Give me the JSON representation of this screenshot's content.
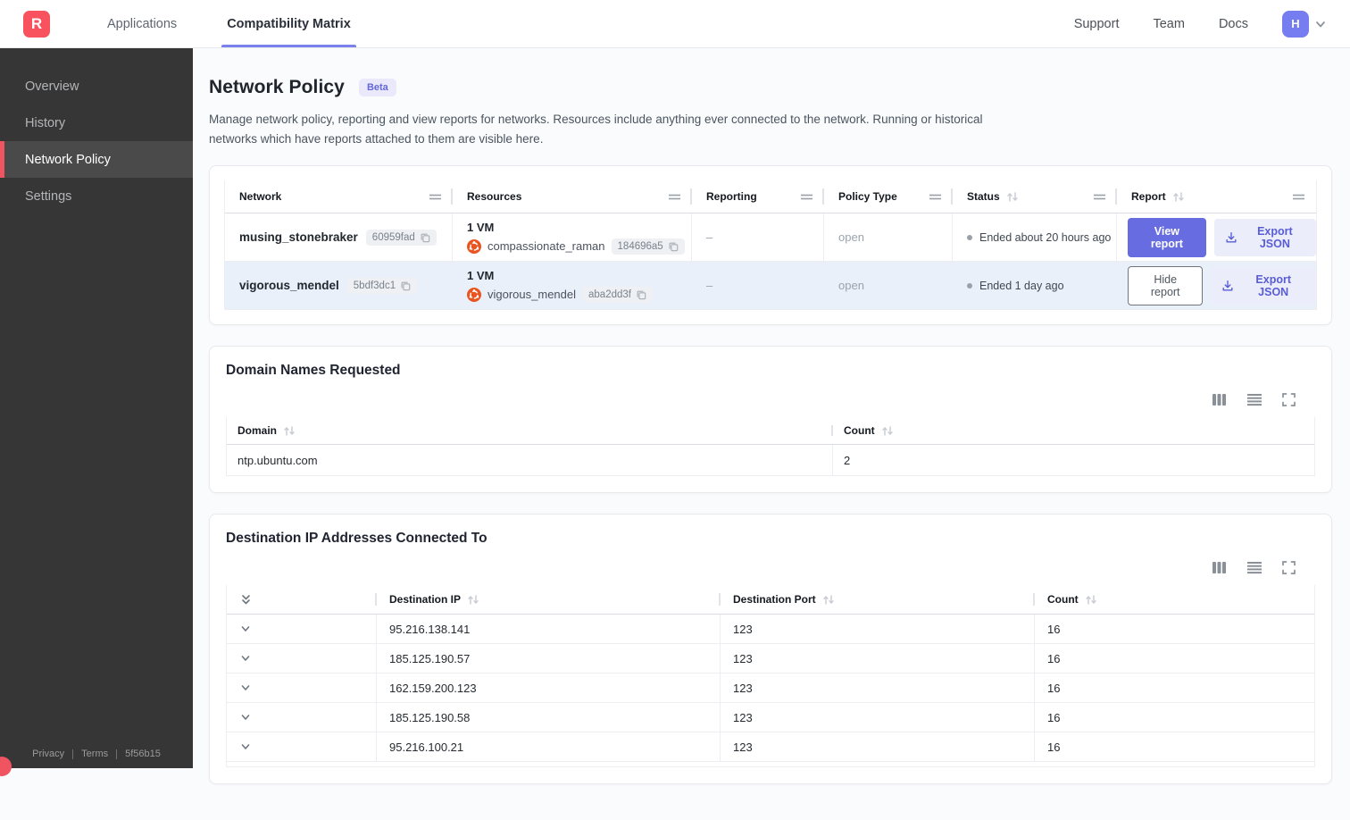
{
  "topnav": {
    "logo_letter": "R",
    "tabs": [
      {
        "label": "Applications",
        "active": false
      },
      {
        "label": "Compatibility Matrix",
        "active": true
      }
    ],
    "links": [
      "Support",
      "Team",
      "Docs"
    ],
    "avatar_letter": "H"
  },
  "sidebar": {
    "items": [
      {
        "label": "Overview",
        "active": false
      },
      {
        "label": "History",
        "active": false
      },
      {
        "label": "Network Policy",
        "active": true
      },
      {
        "label": "Settings",
        "active": false
      }
    ],
    "footer": {
      "privacy": "Privacy",
      "terms": "Terms",
      "build": "5f56b15"
    }
  },
  "page": {
    "title": "Network Policy",
    "badge": "Beta",
    "description": "Manage network policy, reporting and view reports for networks. Resources include anything ever connected to the network. Running or historical networks which have reports attached to them are visible here."
  },
  "networks_table": {
    "columns": [
      "Network",
      "Resources",
      "Reporting",
      "Policy Type",
      "Status",
      "Report"
    ],
    "rows": [
      {
        "name": "musing_stonebraker",
        "id": "60959fad",
        "vm_count": "1 VM",
        "resource_name": "compassionate_raman",
        "resource_id": "184696a5",
        "reporting": "–",
        "policy_type": "open",
        "status": "Ended about 20 hours ago",
        "report_button": "View report",
        "export_button": "Export JSON"
      },
      {
        "name": "vigorous_mendel",
        "id": "5bdf3dc1",
        "vm_count": "1 VM",
        "resource_name": "vigorous_mendel",
        "resource_id": "aba2dd3f",
        "reporting": "–",
        "policy_type": "open",
        "status": "Ended 1 day ago",
        "report_button": "Hide report",
        "export_button": "Export JSON"
      }
    ]
  },
  "domains_card": {
    "title": "Domain Names Requested",
    "columns": [
      "Domain",
      "Count"
    ],
    "rows": [
      {
        "domain": "ntp.ubuntu.com",
        "count": "2"
      }
    ]
  },
  "ips_card": {
    "title": "Destination IP Addresses Connected To",
    "columns": [
      "Destination IP",
      "Destination Port",
      "Count"
    ],
    "rows": [
      {
        "ip": "95.216.138.141",
        "port": "123",
        "count": "16"
      },
      {
        "ip": "185.125.190.57",
        "port": "123",
        "count": "16"
      },
      {
        "ip": "162.159.200.123",
        "port": "123",
        "count": "16"
      },
      {
        "ip": "185.125.190.58",
        "port": "123",
        "count": "16"
      },
      {
        "ip": "95.216.100.21",
        "port": "123",
        "count": "16"
      }
    ]
  },
  "icons": [
    "copy-icon",
    "download-icon",
    "sort-icon",
    "column-resize-handle-icon",
    "columns-icon",
    "rows-icon",
    "fullscreen-icon",
    "chevron-down-icon",
    "expand-all-icon",
    "ubuntu-vm-icon"
  ],
  "colors": {
    "brand_red": "#f8525e",
    "accent_purple": "#676ce0",
    "accent_purple_light": "#ecedfb",
    "tab_underline": "#7a80ec",
    "avatar_purple": "#767df0",
    "sidebar_bg": "#363636",
    "sidebar_active_red": "#ef5460",
    "row_highlight": "#e9f0fa",
    "ubuntu_orange": "#e95420",
    "beta_badge_bg": "#e9e9fb"
  }
}
